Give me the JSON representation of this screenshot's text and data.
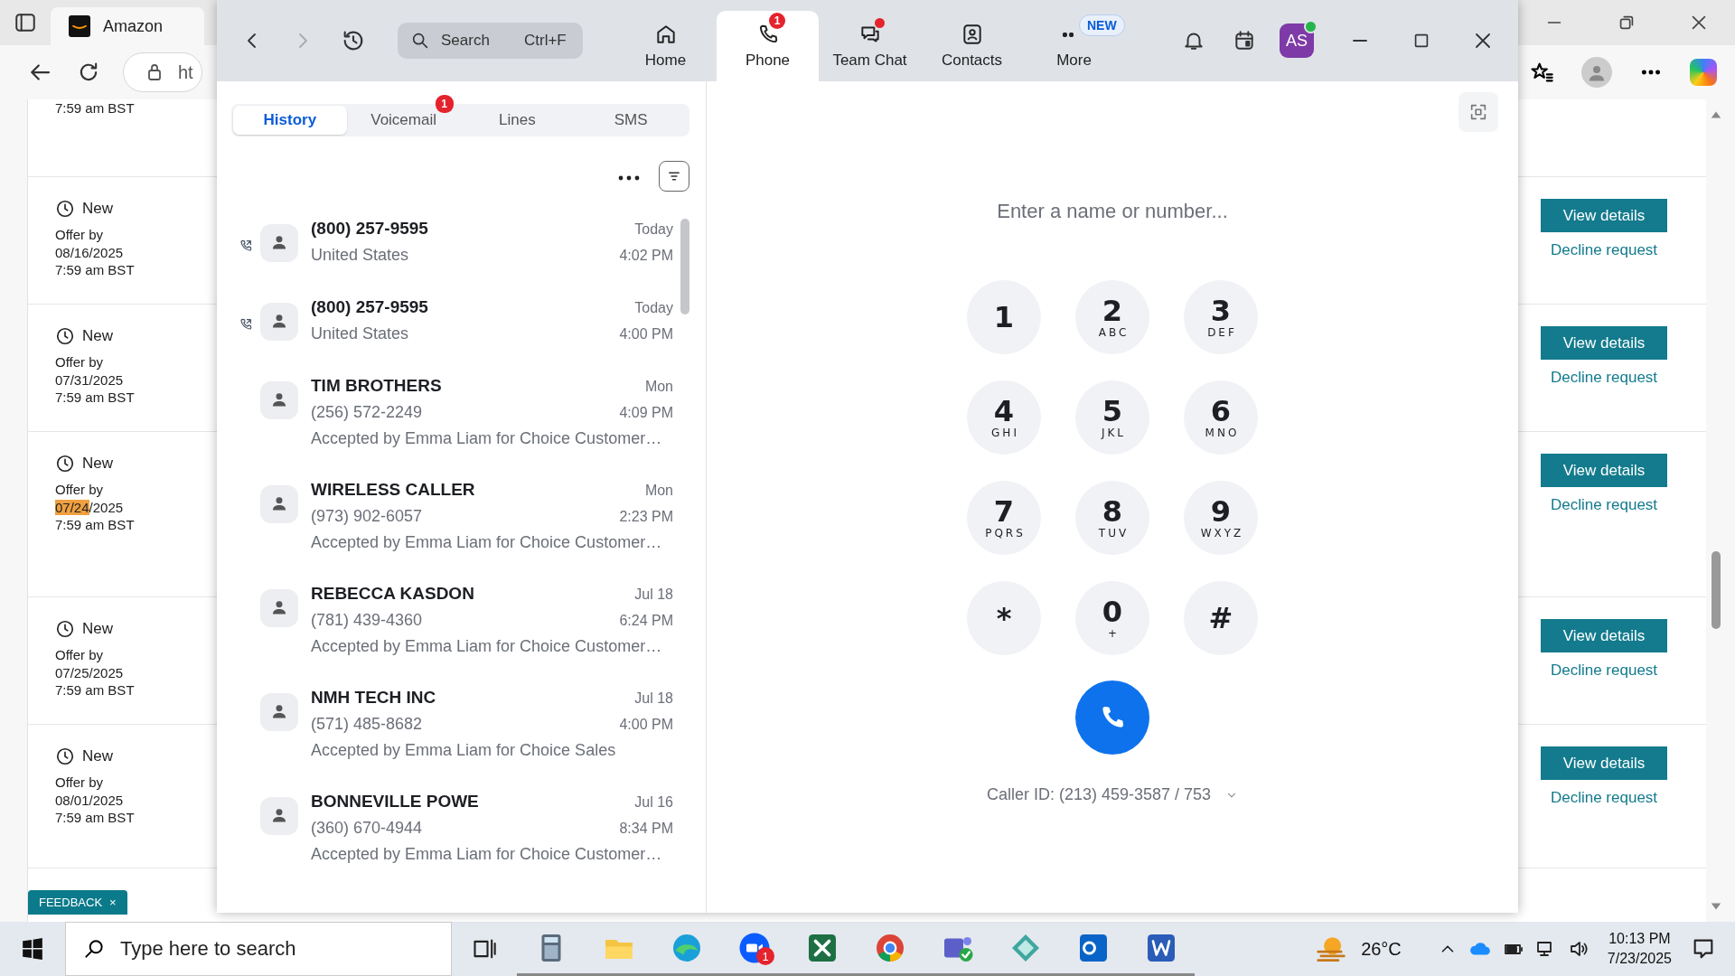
{
  "browser": {
    "tab_title": "Amazon",
    "address": "ht",
    "first_row_time": "7:59 am BST",
    "offers": [
      {
        "status": "New",
        "label": "Offer by",
        "date": "08/16/2025",
        "time": "7:59 am BST",
        "action": "View details",
        "decline": "Decline request"
      },
      {
        "status": "New",
        "label": "Offer by",
        "date": "07/31/2025",
        "time": "7:59 am BST",
        "action": "View details",
        "decline": "Decline request"
      },
      {
        "status": "New",
        "label": "Offer by",
        "date_highlight": "07/24",
        "date": "/2025",
        "time": "7:59 am BST",
        "action": "View details",
        "decline": "Decline request"
      },
      {
        "status": "New",
        "label": "Offer by",
        "date": "07/25/2025",
        "time": "7:59 am BST",
        "action": "View details",
        "decline": "Decline request"
      },
      {
        "status": "New",
        "label": "Offer by",
        "date": "08/01/2025",
        "time": "7:59 am BST",
        "action": "View details",
        "decline": "Decline request"
      }
    ],
    "feedback": "FEEDBACK",
    "feedback_close": "×"
  },
  "zoom": {
    "search": {
      "placeholder": "Search",
      "shortcut": "Ctrl+F"
    },
    "nav": [
      {
        "kind": "home",
        "label": "Home",
        "selected": false
      },
      {
        "kind": "phone",
        "label": "Phone",
        "selected": true,
        "badge": "1"
      },
      {
        "kind": "chat",
        "label": "Team Chat",
        "selected": false,
        "dot": true
      },
      {
        "kind": "contacts",
        "label": "Contacts",
        "selected": false
      },
      {
        "kind": "more",
        "label": "More",
        "selected": false,
        "tag": "NEW"
      }
    ],
    "avatar": "AS",
    "tabs": [
      {
        "label": "History",
        "selected": true
      },
      {
        "label": "Voicemail",
        "selected": false,
        "badge": "1"
      },
      {
        "label": "Lines",
        "selected": false
      },
      {
        "label": "SMS",
        "selected": false
      }
    ],
    "calls": [
      {
        "kind": "outgoing",
        "name": "(800) 257-9595",
        "sub": "United States",
        "day": "Today",
        "time": "4:02 PM"
      },
      {
        "kind": "outgoing",
        "name": "(800) 257-9595",
        "sub": "United States",
        "day": "Today",
        "time": "4:00 PM"
      },
      {
        "kind": "plain",
        "name": "TIM BROTHERS",
        "sub": "(256) 572-2249",
        "note": "Accepted by Emma Liam for Choice Customer…",
        "day": "Mon",
        "time": "4:09 PM"
      },
      {
        "kind": "plain",
        "name": "WIRELESS CALLER",
        "sub": "(973) 902-6057",
        "note": "Accepted by Emma Liam for Choice Customer…",
        "day": "Mon",
        "time": "2:23 PM"
      },
      {
        "kind": "plain",
        "name": "REBECCA KASDON",
        "sub": "(781) 439-4360",
        "note": "Accepted by Emma Liam for Choice Customer…",
        "day": "Jul 18",
        "time": "6:24 PM"
      },
      {
        "kind": "plain",
        "name": "NMH TECH INC",
        "sub": "(571) 485-8682",
        "note": "Accepted by Emma Liam for Choice Sales",
        "day": "Jul 18",
        "time": "4:00 PM"
      },
      {
        "kind": "plain",
        "name": "BONNEVILLE POWE",
        "sub": "(360) 670-4944",
        "note": "Accepted by Emma Liam for Choice Customer…",
        "day": "Jul 16",
        "time": "8:34 PM"
      }
    ],
    "dial_placeholder": "Enter a name or number...",
    "keys": [
      {
        "digit": "1"
      },
      {
        "digit": "2",
        "letters": "ABC"
      },
      {
        "digit": "3",
        "letters": "DEF"
      },
      {
        "digit": "4",
        "letters": "GHI"
      },
      {
        "digit": "5",
        "letters": "JKL"
      },
      {
        "digit": "6",
        "letters": "MNO"
      },
      {
        "digit": "7",
        "letters": "PQRS"
      },
      {
        "digit": "8",
        "letters": "TUV"
      },
      {
        "digit": "9",
        "letters": "WXYZ"
      },
      {
        "digit": "*"
      },
      {
        "digit": "0",
        "letters": "+"
      },
      {
        "digit": "#"
      }
    ],
    "caller_id": "Caller ID: (213) 459-3587 / 753"
  },
  "taskbar": {
    "search_placeholder": "Type here to search",
    "apps": [
      {
        "kind": "calculator"
      },
      {
        "kind": "folder"
      },
      {
        "kind": "edge"
      },
      {
        "kind": "zoom",
        "badge": "1"
      },
      {
        "kind": "excel"
      },
      {
        "kind": "chrome"
      },
      {
        "kind": "teams"
      },
      {
        "kind": "diamond"
      },
      {
        "kind": "outlook"
      },
      {
        "kind": "word"
      }
    ],
    "temperature": "26°C",
    "time": "10:13 PM",
    "date": "7/23/2025"
  }
}
